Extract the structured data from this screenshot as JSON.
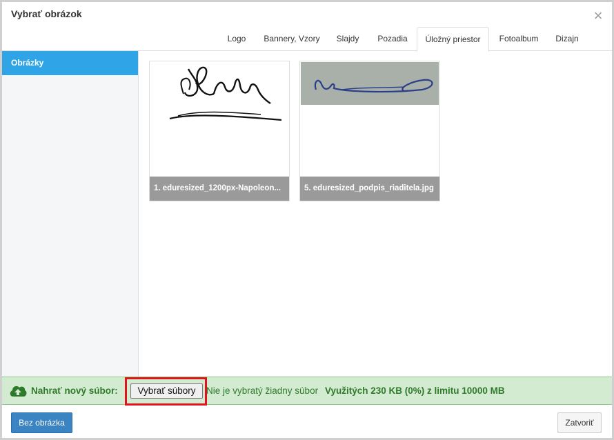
{
  "dialog": {
    "title": "Vybrať obrázok",
    "close_symbol": "×"
  },
  "tabs": [
    {
      "label": "Logo",
      "active": false
    },
    {
      "label": "Bannery, Vzory",
      "active": false
    },
    {
      "label": "Slajdy",
      "active": false
    },
    {
      "label": "Pozadia",
      "active": false
    },
    {
      "label": "Úložný priestor",
      "active": true
    },
    {
      "label": "Fotoalbum",
      "active": false
    },
    {
      "label": "Dizajn",
      "active": false
    }
  ],
  "sidebar": {
    "items": [
      {
        "label": "Obrázky",
        "active": true
      }
    ]
  },
  "images": [
    {
      "caption": "1. eduresized_1200px-Napoleon...",
      "thumb": "signature-black-on-white"
    },
    {
      "caption": "5. eduresized_podpis_riaditela.jpg",
      "thumb": "signature-blue-on-gray"
    }
  ],
  "upload": {
    "label": "Nahrať nový súbor:",
    "button_label": "Vybrať súbory",
    "status": "Nie je vybratý žiadny súbor",
    "usage": "Využitých 230 KB (0%) z limitu 10000 MB",
    "icon": "cloud-upload-icon"
  },
  "footer": {
    "no_image_button": "Bez obrázka",
    "close_button": "Zatvoriť"
  },
  "colors": {
    "accent": "#2fa4e7",
    "primary_button": "#3a84c4",
    "upload_bg": "#d3ebd1",
    "upload_text": "#2f7a2a",
    "highlight": "#e0141a"
  }
}
